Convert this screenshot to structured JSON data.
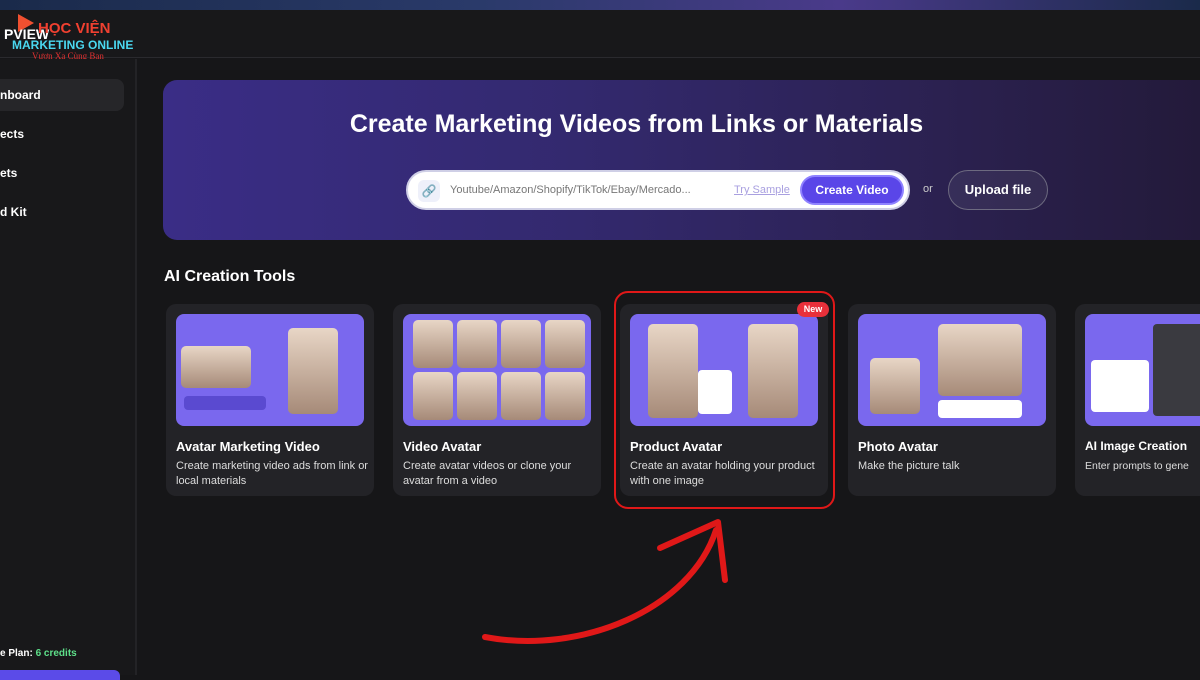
{
  "logo": {
    "brand": "PVIEW",
    "watermark_line1": "HỌC VIỆN",
    "watermark_line2": "MARKETING ONLINE",
    "watermark_line3": "Vươn Xa Cùng Bạn"
  },
  "sidebar": {
    "items": [
      {
        "label": "nboard",
        "active": true
      },
      {
        "label": "ects"
      },
      {
        "label": "ets"
      },
      {
        "label": "d Kit"
      }
    ],
    "plan_label": "e Plan:",
    "plan_credits": "6 credits"
  },
  "banner": {
    "title": "Create Marketing Videos from Links or Materials",
    "input_placeholder": "Youtube/Amazon/Shopify/TikTok/Ebay/Mercado...",
    "try_sample": "Try Sample",
    "create_video": "Create Video",
    "or": "or",
    "upload_file": "Upload file"
  },
  "section_title": "AI Creation Tools",
  "tools": [
    {
      "title": "Avatar Marketing Video",
      "desc": "Create marketing video ads from link or local materials"
    },
    {
      "title": "Video Avatar",
      "desc": "Create avatar videos or clone your avatar from a video"
    },
    {
      "title": "Product Avatar",
      "desc": "Create an avatar holding your product with one image",
      "badge": "New",
      "highlighted": true
    },
    {
      "title": "Photo Avatar",
      "desc": "Make the picture talk"
    },
    {
      "title": "AI Image Creation",
      "desc": "Enter prompts to gene"
    }
  ],
  "colors": {
    "accent": "#5a46e8",
    "highlight": "#e01818",
    "credits": "#5ee08a",
    "card_image": "#7a68ee"
  }
}
